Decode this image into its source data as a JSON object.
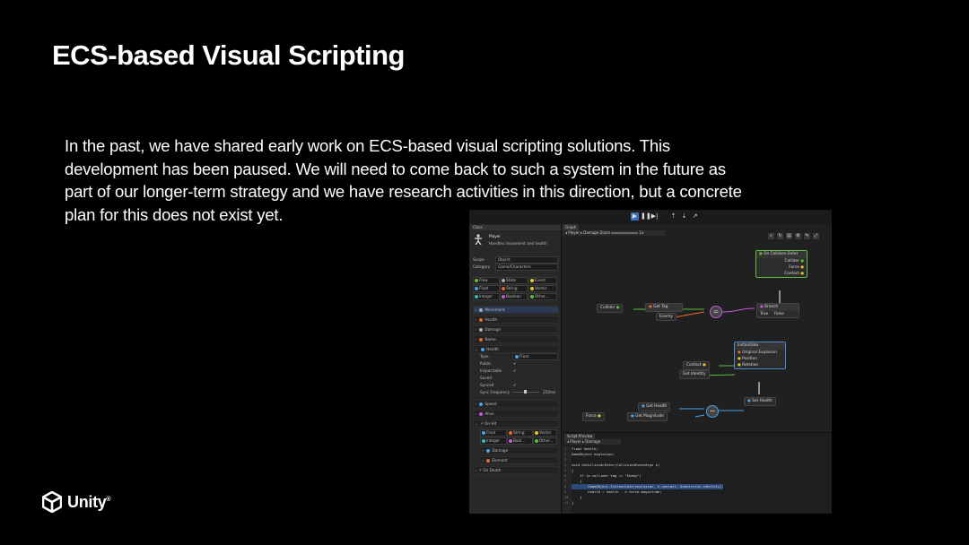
{
  "slide": {
    "title": "ECS-based Visual Scripting",
    "body": "In the past, we have shared early work on ECS-based visual scripting solutions. This development has been paused. We will need to come back to such a system in the future as part of our longer-term strategy and we have research activities in this direction, but a concrete plan for this does not exist yet.",
    "logo_text": "Unity",
    "logo_tm": "®"
  },
  "editor": {
    "inspector": {
      "header": "Class",
      "name": "Player",
      "description": "Handles movement and health",
      "scope_label": "Scope",
      "scope_value": "Object",
      "category_label": "Category",
      "category_value": "Game/Characters",
      "type_chips_row1": [
        "Flow",
        "State",
        "Event"
      ],
      "type_chips_row2": [
        "Float",
        "String",
        "Vector"
      ],
      "type_chips_row3": [
        "Integer",
        "Boolean",
        "Other..."
      ],
      "variables": [
        "Movement",
        "Health",
        "Damage",
        "Name",
        "Health"
      ],
      "props": [
        {
          "label": "Type",
          "value": "Float"
        },
        {
          "label": "Public",
          "value": "✓"
        },
        {
          "label": "Inspectable",
          "value": "✓"
        },
        {
          "label": "Saved",
          "value": ""
        },
        {
          "label": "Synced",
          "value": "✓"
        },
        {
          "label": "Sync Frequency",
          "value": "250ms"
        }
      ],
      "variables2": [
        "Speed",
        "Alive",
        "On Hit"
      ],
      "hit_chips_row1": [
        "Float",
        "String",
        "Vector"
      ],
      "hit_chips_row2": [
        "Integer",
        "Bool...",
        "Other..."
      ],
      "hit_children": [
        "Damage",
        "Element"
      ],
      "last_event": "On Death"
    },
    "graph": {
      "tab": "Graph",
      "breadcrumb": "◂ Player  ▸ Damage   Zoom",
      "zoom": "1x",
      "nodes": {
        "on_collision_enter": "On Collision Enter",
        "collider": "Collider",
        "force": "Force",
        "contact": "Contact",
        "collider_pill": "Collider",
        "get_tag": "Get Tag",
        "enemy": "Enemy",
        "branch": "Branch",
        "true": "True",
        "false": "False",
        "instantiate": "Instantiate",
        "original": "Original",
        "explosion": "Explosion",
        "position": "Position",
        "rotation": "Rotation",
        "contact_pill": "Contact",
        "get_identity": "Get Identity",
        "set_health": "Set Health",
        "get_health": "Get Health",
        "force_pill": "Force",
        "get_magnitude": "Get Magnitude"
      }
    },
    "script": {
      "tab": "Script Preview",
      "breadcrumb": "◂ Player  ▸ Damage",
      "lines": [
        "float health;",
        "GameObject explosion;",
        "",
        "void OnCollisionEnter(CollisionEventArgs e)",
        "{",
        "    if (e.collider.tag == \"Enemy\")",
        "    {",
        "        GameObject.Instantiate(explosion, e.contact, Quaternion.identity);",
        "        health = health - e.force.magnitude;",
        "    }",
        "}"
      ],
      "line_numbers": [
        "1",
        "2",
        "3",
        "4",
        "5",
        "6",
        "7",
        "8",
        "9",
        "10",
        "11"
      ]
    },
    "colors": {
      "flow": "#5cbf3a",
      "float": "#4aa3e8",
      "string": "#e86b2a",
      "boolean": "#c45cd8",
      "integer": "#2fc0c0",
      "vector": "#e8c72a",
      "event": "#e8d23a"
    }
  }
}
